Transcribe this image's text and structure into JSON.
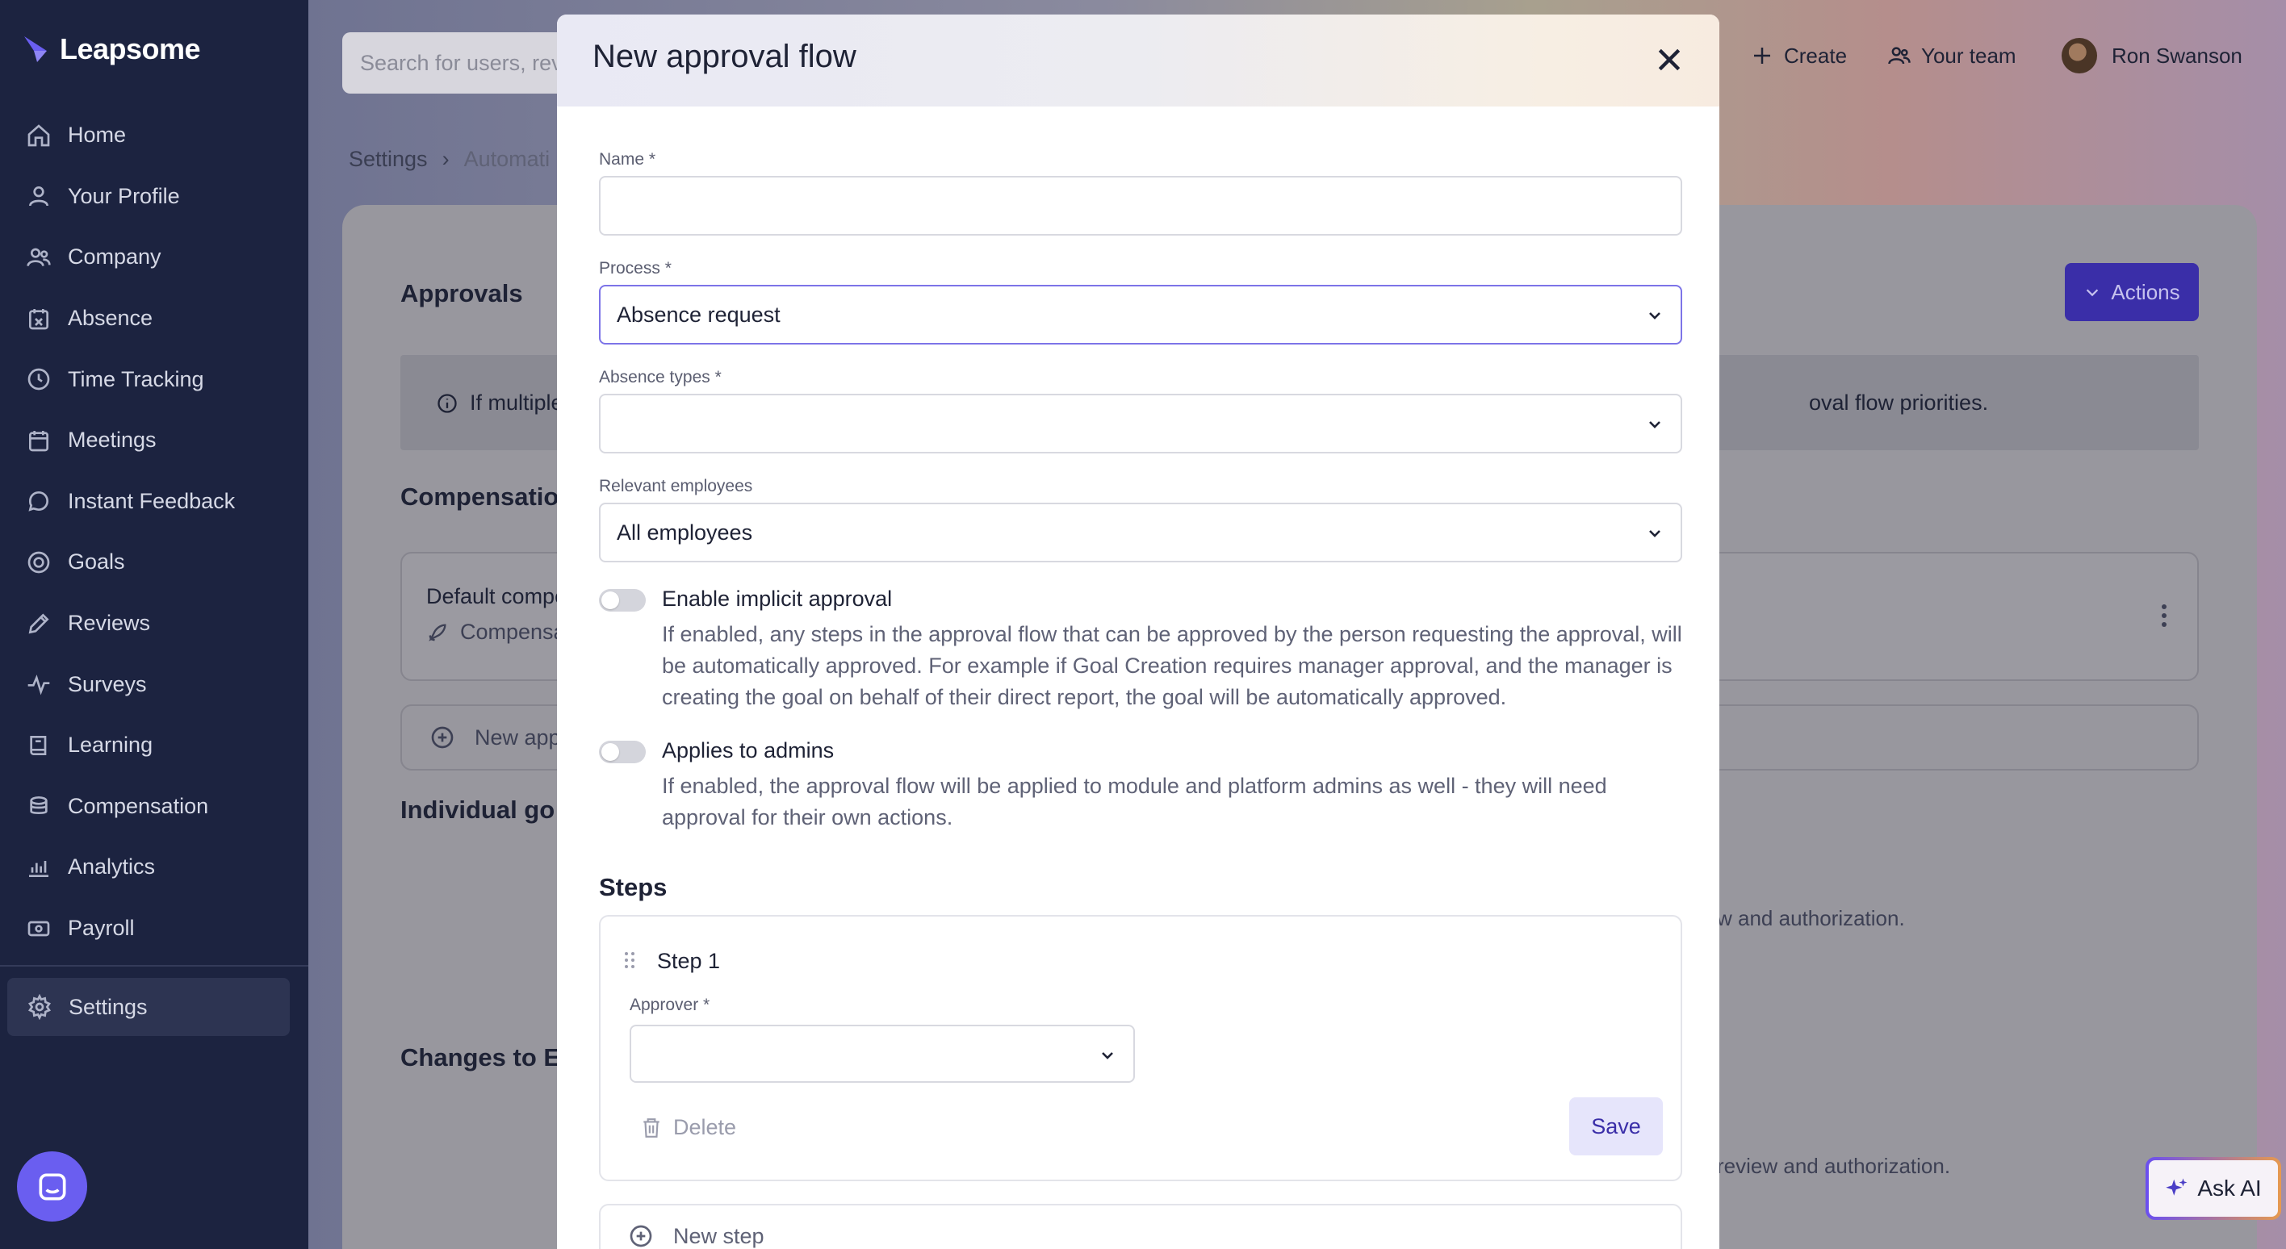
{
  "app": {
    "name": "Leapsome"
  },
  "sidebar": {
    "items": [
      {
        "label": "Home",
        "icon": "home-icon"
      },
      {
        "label": "Your Profile",
        "icon": "user-icon"
      },
      {
        "label": "Company",
        "icon": "users-icon"
      },
      {
        "label": "Absence",
        "icon": "calendar-x-icon"
      },
      {
        "label": "Time Tracking",
        "icon": "clock-icon"
      },
      {
        "label": "Meetings",
        "icon": "calendar-icon"
      },
      {
        "label": "Instant Feedback",
        "icon": "chat-icon"
      },
      {
        "label": "Goals",
        "icon": "target-icon"
      },
      {
        "label": "Reviews",
        "icon": "pen-icon"
      },
      {
        "label": "Surveys",
        "icon": "pulse-icon"
      },
      {
        "label": "Learning",
        "icon": "book-icon"
      },
      {
        "label": "Compensation",
        "icon": "coins-icon"
      },
      {
        "label": "Analytics",
        "icon": "chart-icon"
      },
      {
        "label": "Payroll",
        "icon": "money-icon"
      }
    ],
    "settings_label": "Settings"
  },
  "topbar": {
    "search_placeholder": "Search for users, revi",
    "create_label": "Create",
    "team_label": "Your team",
    "user_name": "Ron Swanson"
  },
  "breadcrumb": {
    "root": "Settings",
    "current": "Automati"
  },
  "page": {
    "title": "Approvals",
    "actions_label": "Actions",
    "info_left": "If multiple",
    "info_right": "oval flow priorities.",
    "section_compensation": "Compensatio",
    "flow_name": "Default compe",
    "flow_sub": "Compensa",
    "new_approval_label": "New app",
    "section_goals": "Individual go",
    "goals_text": "w and authorization.",
    "section_changes": "Changes to E",
    "changes_text": "review and authorization."
  },
  "ask_ai_label": "Ask AI",
  "modal": {
    "title": "New approval flow",
    "name_label": "Name *",
    "name_value": "",
    "process_label": "Process *",
    "process_value": "Absence request",
    "absence_types_label": "Absence types *",
    "absence_types_value": "",
    "relevant_label": "Relevant employees",
    "relevant_value": "All employees",
    "implicit_label": "Enable implicit approval",
    "implicit_desc": "If enabled, any steps in the approval flow that can be approved by the person requesting the approval, will be automatically approved. For example if Goal Creation requires manager approval, and the manager is creating the goal on behalf of their direct report, the goal will be automatically approved.",
    "admins_label": "Applies to admins",
    "admins_desc": "If enabled, the approval flow will be applied to module and platform admins as well - they will need approval for their own actions.",
    "steps_title": "Steps",
    "step_name": "Step 1",
    "approver_label": "Approver *",
    "approver_value": "",
    "delete_label": "Delete",
    "save_label": "Save",
    "new_step_label": "New step"
  }
}
